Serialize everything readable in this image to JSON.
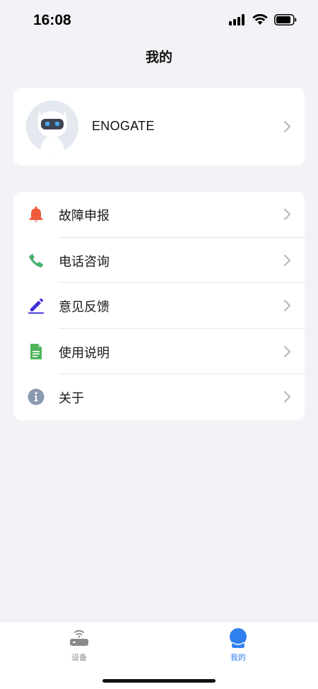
{
  "status_bar": {
    "time": "16:08"
  },
  "header": {
    "title": "我的"
  },
  "profile": {
    "username": "ENOGATE"
  },
  "menu": {
    "items": [
      {
        "label": "故障申报",
        "icon": "bell-icon",
        "color": "#ef5b3b"
      },
      {
        "label": "电话咨询",
        "icon": "phone-icon",
        "color": "#4caf6e"
      },
      {
        "label": "意见反馈",
        "icon": "pencil-icon",
        "color": "#3d2fd9"
      },
      {
        "label": "使用说明",
        "icon": "document-icon",
        "color": "#4fb35b"
      },
      {
        "label": "关于",
        "icon": "info-icon",
        "color": "#8a98b0"
      }
    ]
  },
  "tab_bar": {
    "tabs": [
      {
        "label": "设备",
        "icon": "router-icon",
        "active": false
      },
      {
        "label": "我的",
        "icon": "user-icon",
        "active": true
      }
    ],
    "active_color": "#2f80ed",
    "inactive_color": "#8a8a8a"
  }
}
